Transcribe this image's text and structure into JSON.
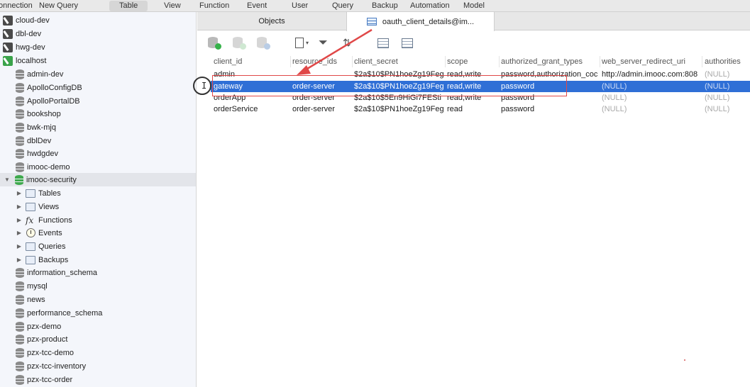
{
  "toolbar": {
    "items": [
      "onnection",
      "New Query",
      "Table",
      "View",
      "Function",
      "Event",
      "User",
      "Query",
      "Backup",
      "Automation",
      "Model"
    ],
    "active": "Table"
  },
  "sidebar": {
    "connections": [
      {
        "label": "cloud-dev",
        "icon": "connection-icon"
      },
      {
        "label": "dbl-dev",
        "icon": "connection-icon"
      },
      {
        "label": "hwg-dev",
        "icon": "connection-icon"
      },
      {
        "label": "localhost",
        "icon": "connection-icon-green"
      }
    ],
    "databases_before": [
      "admin-dev",
      "ApolloConfigDB",
      "ApolloPortalDB",
      "bookshop",
      "bwk-mjq",
      "dblDev",
      "hwdgdev",
      "imooc-demo"
    ],
    "selected_db": "imooc-security",
    "sub_items": [
      "Tables",
      "Views",
      "Functions",
      "Events",
      "Queries",
      "Backups"
    ],
    "databases_after": [
      "information_schema",
      "mysql",
      "news",
      "performance_schema",
      "pzx-demo",
      "pzx-product",
      "pzx-tcc-demo",
      "pzx-tcc-inventory",
      "pzx-tcc-order"
    ]
  },
  "tabs": {
    "objects": "Objects",
    "active": "oauth_client_details@im..."
  },
  "grid": {
    "columns": [
      "client_id",
      "resource_ids",
      "client_secret",
      "scope",
      "authorized_grant_types",
      "web_server_redirect_uri",
      "authorities"
    ],
    "rows": [
      [
        "admin",
        "",
        "$2a$10$PN1hoeZg19Feg",
        "read,write",
        "password,authorization_coc",
        "http://admin.imooc.com:808",
        "(NULL)"
      ],
      [
        "gateway",
        "order-server",
        "$2a$10$PN1hoeZg19Feg",
        "read,write",
        "password",
        "(NULL)",
        "(NULL)"
      ],
      [
        "orderApp",
        "order-server",
        "$2a$10$5En9HiGi7FESti",
        "read,write",
        "password",
        "(NULL)",
        "(NULL)"
      ],
      [
        "orderService",
        "order-server",
        "$2a$10$PN1hoeZg19Feg",
        "read",
        "password",
        "(NULL)",
        "(NULL)"
      ]
    ],
    "selected_row": 1
  },
  "colors": {
    "selection": "#2f6fd6",
    "annotation": "#e04848",
    "db_active": "#3ea94d"
  }
}
